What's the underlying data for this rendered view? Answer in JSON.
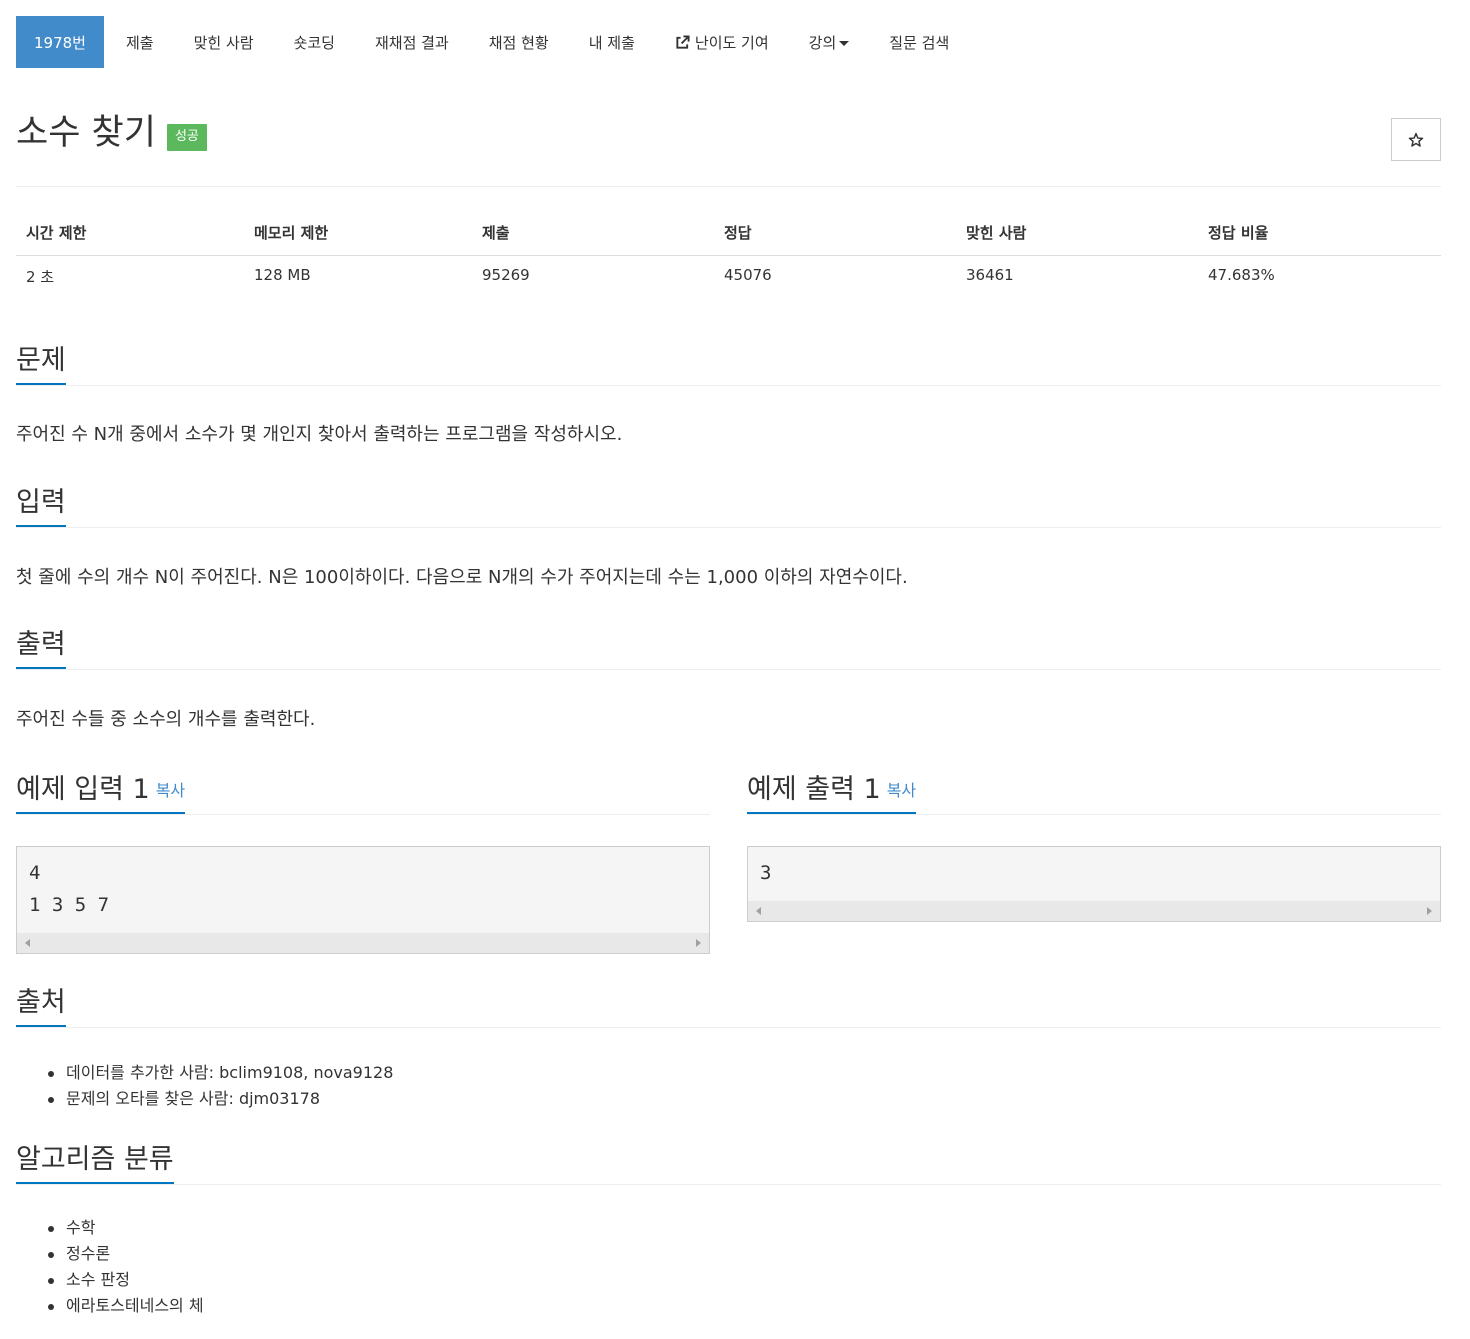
{
  "tabs": [
    {
      "label": "1978번",
      "active": true
    },
    {
      "label": "제출"
    },
    {
      "label": "맞힌 사람"
    },
    {
      "label": "숏코딩"
    },
    {
      "label": "재채점 결과"
    },
    {
      "label": "채점 현황"
    },
    {
      "label": "내 제출"
    },
    {
      "label": "난이도 기여",
      "icon": "external-link-icon"
    },
    {
      "label": "강의",
      "icon": "caret-down-icon"
    },
    {
      "label": "질문 검색"
    }
  ],
  "problem": {
    "title": "소수 찾기",
    "status_badge": "성공",
    "favorite_icon": "star-icon"
  },
  "info_table": {
    "headers": [
      "시간 제한",
      "메모리 제한",
      "제출",
      "정답",
      "맞힌 사람",
      "정답 비율"
    ],
    "values": [
      "2 초",
      "128 MB",
      "95269",
      "45076",
      "36461",
      "47.683%"
    ]
  },
  "sections": {
    "description": {
      "heading": "문제",
      "text": "주어진 수 N개 중에서 소수가 몇 개인지 찾아서 출력하는 프로그램을 작성하시오."
    },
    "input": {
      "heading": "입력",
      "text": "첫 줄에 수의 개수 N이 주어진다. N은 100이하이다. 다음으로 N개의 수가 주어지는데 수는 1,000 이하의 자연수이다."
    },
    "output": {
      "heading": "출력",
      "text": "주어진 수들 중 소수의 개수를 출력한다."
    }
  },
  "samples": {
    "input": {
      "heading": "예제 입력 1",
      "copy_label": "복사",
      "lines": [
        "4",
        "1 3 5 7"
      ]
    },
    "output": {
      "heading": "예제 출력 1",
      "copy_label": "복사",
      "lines": [
        "3"
      ]
    }
  },
  "source": {
    "heading": "출처",
    "items": [
      {
        "prefix": "데이터를 추가한 사람: ",
        "value": "bclim9108, nova9128"
      },
      {
        "prefix": "문제의 오타를 찾은 사람: ",
        "value": "djm03178"
      }
    ]
  },
  "algorithm": {
    "heading": "알고리즘 분류",
    "items": [
      "수학",
      "정수론",
      "소수 판정",
      "에라토스테네스의 체"
    ]
  },
  "colors": {
    "accent": "#428bca",
    "success": "#5cb85c",
    "heading_underline": "#0076c0"
  }
}
